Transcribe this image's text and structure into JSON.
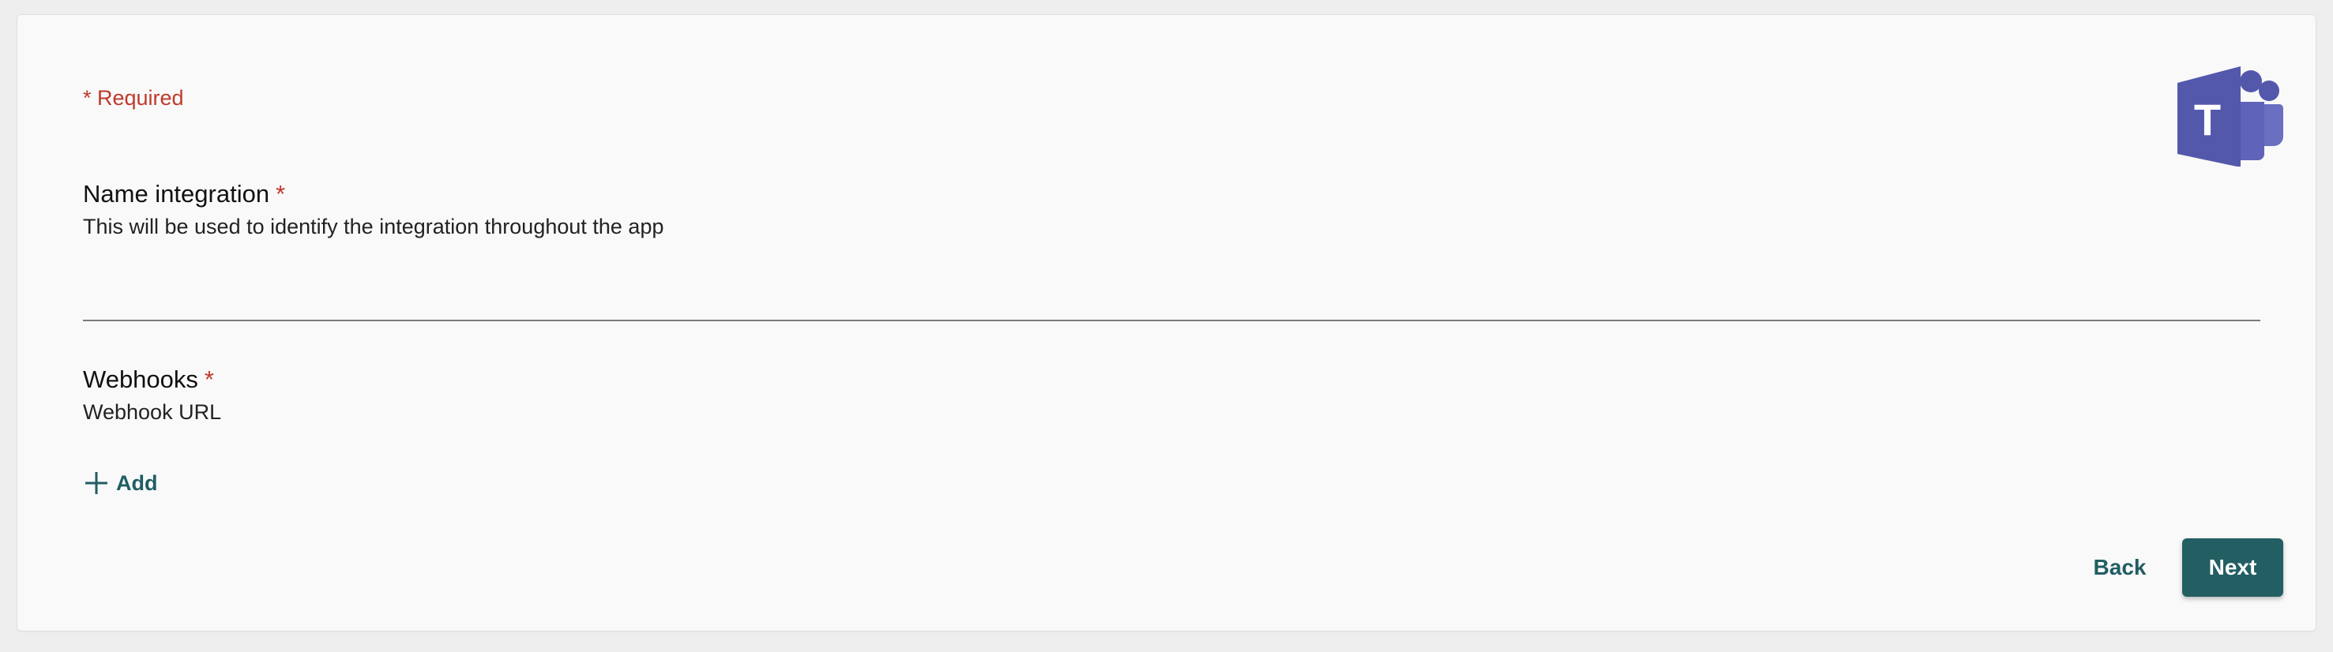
{
  "form": {
    "required_note": "* Required",
    "name_section": {
      "title": "Name integration",
      "required_marker": "*",
      "description": "This will be used to identify the integration throughout the app",
      "input_value": "",
      "input_placeholder": ""
    },
    "webhooks_section": {
      "title": "Webhooks",
      "required_marker": "*",
      "description": "Webhook URL",
      "add_label": "Add"
    }
  },
  "actions": {
    "back_label": "Back",
    "next_label": "Next"
  },
  "branding": {
    "logo_icon": "microsoft-teams-logo-icon",
    "logo_letter": "T",
    "logo_color": "#5458ab"
  },
  "colors": {
    "accent": "#235e62",
    "required": "#c0392b"
  }
}
